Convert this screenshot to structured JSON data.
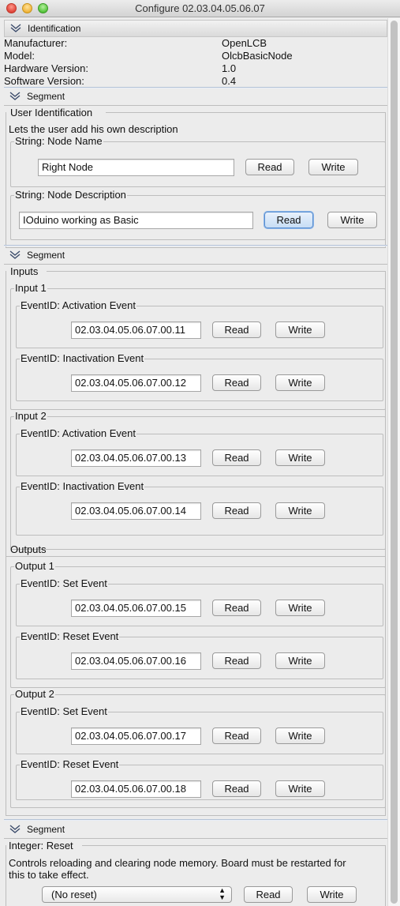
{
  "window": {
    "title": "Configure 02.03.04.05.06.07"
  },
  "identification": {
    "header": "Identification",
    "rows": [
      {
        "label": "Manufacturer:",
        "value": "OpenLCB"
      },
      {
        "label": "Model:",
        "value": "OlcbBasicNode"
      },
      {
        "label": "Hardware Version:",
        "value": "1.0"
      },
      {
        "label": "Software Version:",
        "value": "0.4"
      }
    ]
  },
  "segment1": {
    "header": "Segment",
    "group": "User Identification",
    "description": "Lets the user add his own description",
    "node_name": {
      "label": "String: Node Name",
      "value": "Right Node",
      "read": "Read",
      "write": "Write"
    },
    "node_description": {
      "label": "String: Node Description",
      "value": "IOduino working as Basic",
      "read": "Read",
      "write": "Write"
    }
  },
  "segment2": {
    "header": "Segment",
    "inputs": {
      "label": "Inputs",
      "input1": {
        "label": "Input 1",
        "activation": {
          "label": "EventID: Activation Event",
          "value": "02.03.04.05.06.07.00.11",
          "read": "Read",
          "write": "Write"
        },
        "inactivation": {
          "label": "EventID: Inactivation Event",
          "value": "02.03.04.05.06.07.00.12",
          "read": "Read",
          "write": "Write"
        }
      },
      "input2": {
        "label": "Input 2",
        "activation": {
          "label": "EventID: Activation Event",
          "value": "02.03.04.05.06.07.00.13",
          "read": "Read",
          "write": "Write"
        },
        "inactivation": {
          "label": "EventID: Inactivation Event",
          "value": "02.03.04.05.06.07.00.14",
          "read": "Read",
          "write": "Write"
        }
      }
    },
    "outputs": {
      "label": "Outputs",
      "output1": {
        "label": "Output 1",
        "set": {
          "label": "EventID: Set Event",
          "value": "02.03.04.05.06.07.00.15",
          "read": "Read",
          "write": "Write"
        },
        "reset": {
          "label": "EventID: Reset Event",
          "value": "02.03.04.05.06.07.00.16",
          "read": "Read",
          "write": "Write"
        }
      },
      "output2": {
        "label": "Output 2",
        "set": {
          "label": "EventID: Set Event",
          "value": "02.03.04.05.06.07.00.17",
          "read": "Read",
          "write": "Write"
        },
        "reset": {
          "label": "EventID: Reset Event",
          "value": "02.03.04.05.06.07.00.18",
          "read": "Read",
          "write": "Write"
        }
      }
    }
  },
  "segment3": {
    "header": "Segment",
    "reset": {
      "label": "Integer: Reset",
      "description_line1": "Controls reloading and clearing node memory. Board must be restarted for",
      "description_line2": "this to take effect.",
      "selected": "(No reset)",
      "read": "Read",
      "write": "Write"
    }
  }
}
